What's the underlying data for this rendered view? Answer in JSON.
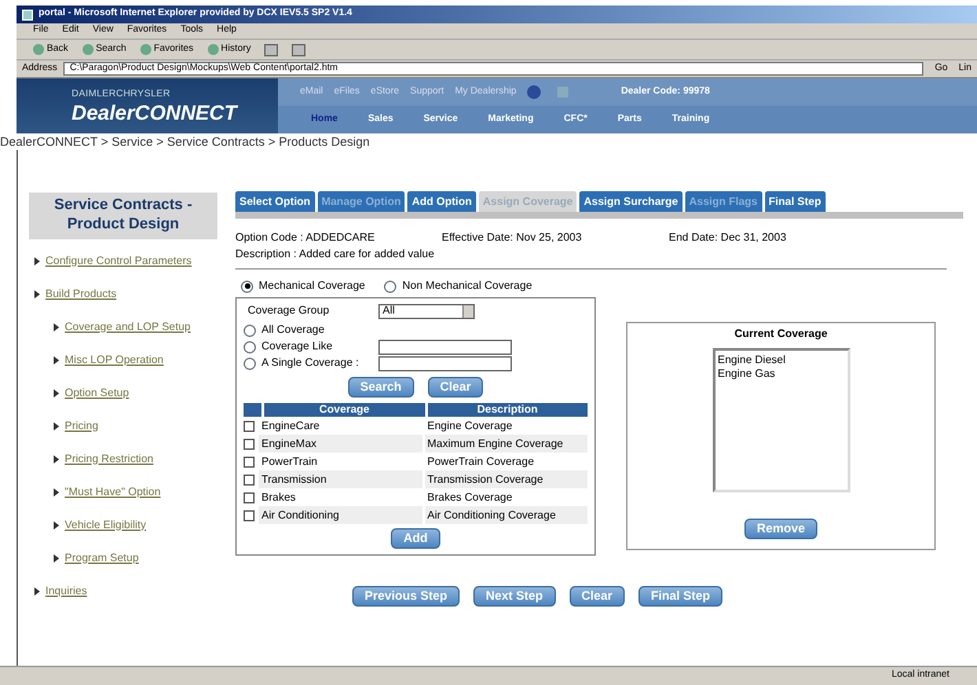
{
  "browser": {
    "title": "portal - Microsoft Internet Explorer provided by DCX IEV5.5 SP2 V1.4",
    "menu": [
      "File",
      "Edit",
      "View",
      "Favorites",
      "Tools",
      "Help"
    ],
    "toolbar": [
      "Back",
      "Search",
      "Favorites",
      "History"
    ],
    "address_label": "Address",
    "address": "C:\\Paragon\\Product Design\\Mockups\\Web Content\\portal2.htm",
    "go": "Go",
    "links": "Lin"
  },
  "header": {
    "logo_top": "DAIMLERCHRYSLER",
    "logo_main": "DealerCONNECT",
    "top_links": [
      "eMail",
      "eFiles",
      "eStore",
      "Support",
      "My Dealership"
    ],
    "dealer_code": "Dealer Code: 99978",
    "nav": [
      {
        "label": "Home",
        "selected": true
      },
      {
        "label": "Sales",
        "selected": false
      },
      {
        "label": "Service",
        "selected": false
      },
      {
        "label": "Marketing",
        "selected": false
      },
      {
        "label": "CFC*",
        "selected": false
      },
      {
        "label": "Parts",
        "selected": false
      },
      {
        "label": "Training",
        "selected": false
      }
    ]
  },
  "breadcrumb": "DealerCONNECT > Service > Service Contracts > Products Design",
  "sidebar": {
    "heading": "Service Contracts - Product Design",
    "items": [
      {
        "label": "Configure Control Parameters"
      },
      {
        "label": "Build Products",
        "children": [
          {
            "label": "Coverage and LOP Setup"
          },
          {
            "label": "Misc LOP Operation"
          },
          {
            "label": "Option Setup"
          },
          {
            "label": "Pricing"
          },
          {
            "label": "Pricing Restriction"
          },
          {
            "label": "\"Must Have\" Option"
          },
          {
            "label": "Vehicle Eligibility"
          },
          {
            "label": "Program Setup"
          }
        ]
      },
      {
        "label": "Inquiries"
      }
    ]
  },
  "tabs": [
    {
      "label": "Select Option",
      "selected": false,
      "disabled": false
    },
    {
      "label": "Manage Option",
      "selected": false,
      "disabled": true
    },
    {
      "label": "Add Option",
      "selected": false,
      "disabled": false
    },
    {
      "label": "Assign Coverage",
      "selected": true,
      "disabled": false
    },
    {
      "label": "Assign Surcharge",
      "selected": false,
      "disabled": false
    },
    {
      "label": "Assign Flags",
      "selected": false,
      "disabled": true
    },
    {
      "label": "Final Step",
      "selected": false,
      "disabled": false
    }
  ],
  "option": {
    "code": "Option Code : ADDEDCARE",
    "description": "Description : Added care for added value",
    "effective": "Effective Date: Nov 25, 2003",
    "end": "End Date: Dec 31, 2003"
  },
  "coverage_type": [
    {
      "label": "Mechanical Coverage",
      "selected": true
    },
    {
      "label": "Non Mechanical Coverage",
      "selected": false
    }
  ],
  "group_label": "Coverage Group",
  "group_value": "All",
  "filters": [
    {
      "label": "All Coverage",
      "selected": false,
      "kind": "plain"
    },
    {
      "label": "Coverage Like",
      "selected": false,
      "kind": "field"
    },
    {
      "label": "A Single Coverage :",
      "selected": false,
      "kind": "field"
    }
  ],
  "search_buttons": [
    "Search",
    "Clear"
  ],
  "table": {
    "columns": [
      "Coverage",
      "Description"
    ],
    "rows": [
      {
        "coverage": "EngineCare",
        "description": "Engine Coverage",
        "checked": false
      },
      {
        "coverage": "EngineMax",
        "description": "Maximum Engine Coverage",
        "checked": false
      },
      {
        "coverage": "PowerTrain",
        "description": "PowerTrain Coverage",
        "checked": false
      },
      {
        "coverage": "Transmission",
        "description": "Transmission Coverage",
        "checked": false
      },
      {
        "coverage": "Brakes",
        "description": "Brakes Coverage",
        "checked": false
      },
      {
        "coverage": "Air Conditioning",
        "description": "Air Conditioning Coverage",
        "checked": false
      }
    ]
  },
  "add_button": "Add",
  "current": {
    "title": "Current Coverage",
    "items": [
      "Engine Diesel",
      "Engine Gas"
    ],
    "remove": "Remove"
  },
  "steps": [
    "Previous Step",
    "Next Step",
    "Clear",
    "Final Step"
  ],
  "status_bar": {
    "zone": "Local intranet"
  }
}
